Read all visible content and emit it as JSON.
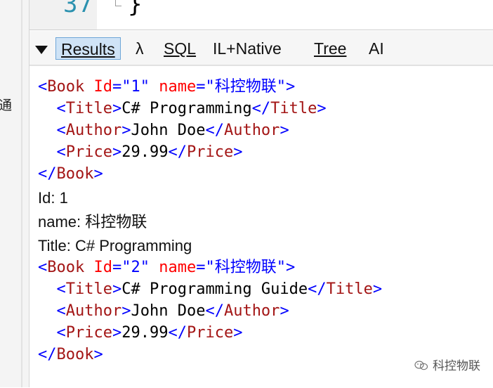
{
  "left_panel": {
    "cut_text": "通"
  },
  "editor": {
    "line_number": "37",
    "code": "}"
  },
  "toolbar": {
    "tabs": [
      {
        "label": "Results",
        "active": true
      },
      {
        "label": "λ",
        "active": false
      },
      {
        "label": "SQL",
        "active": false
      },
      {
        "label": "IL+Native",
        "active": false
      },
      {
        "label": "Tree",
        "active": false
      },
      {
        "label": "AI",
        "active": false
      }
    ]
  },
  "output": {
    "book1": {
      "open": {
        "tag": "Book",
        "attr1": "Id",
        "val1": "\"1\"",
        "attr2": "name",
        "val2": "\"科控物联\""
      },
      "title": {
        "tag": "Title",
        "text": "C# Programming"
      },
      "author": {
        "tag": "Author",
        "text": "John Doe"
      },
      "price": {
        "tag": "Price",
        "text": "29.99"
      },
      "close": {
        "tag": "Book"
      }
    },
    "info": {
      "id_line": "Id: 1",
      "name_line": "name: 科控物联",
      "title_line": "Title: C# Programming"
    },
    "book2": {
      "open": {
        "tag": "Book",
        "attr1": "Id",
        "val1": "\"2\"",
        "attr2": "name",
        "val2": "\"科控物联\""
      },
      "title": {
        "tag": "Title",
        "text": "C# Programming Guide"
      },
      "author": {
        "tag": "Author",
        "text": "John Doe"
      },
      "price": {
        "tag": "Price",
        "text": "29.99"
      },
      "close": {
        "tag": "Book"
      }
    }
  },
  "watermark": {
    "text": "科控物联",
    "icon": "wechat-icon"
  }
}
